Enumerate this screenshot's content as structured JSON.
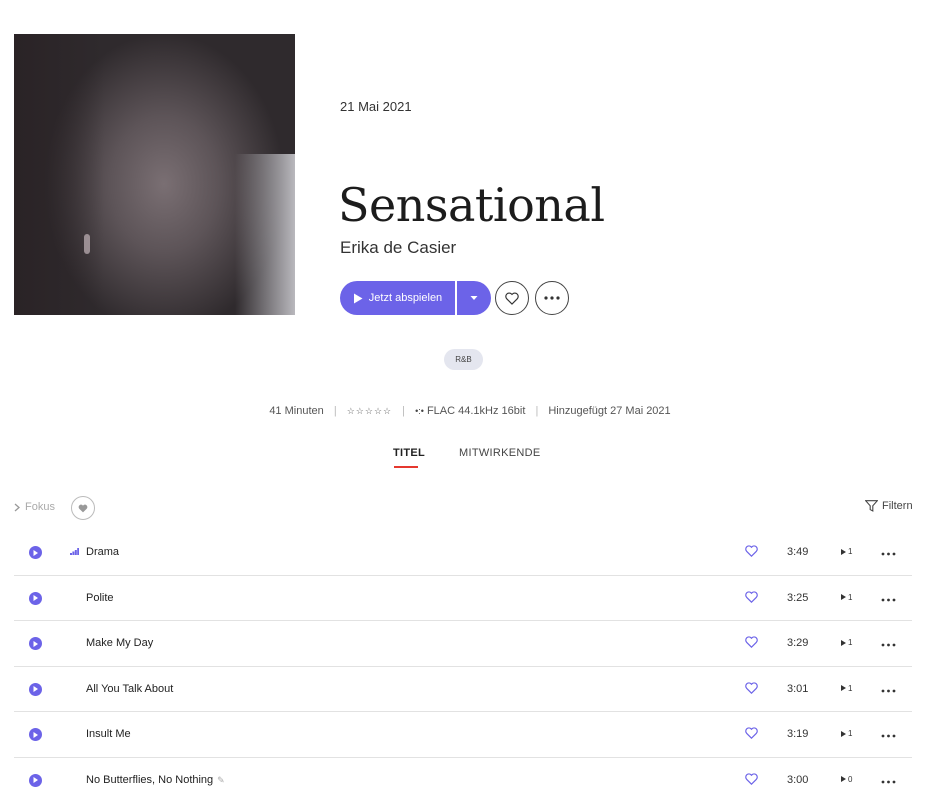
{
  "album": {
    "release_date": "21 Mai 2021",
    "title": "Sensational",
    "artist": "Erika de Casier",
    "genre": "R&B"
  },
  "actions": {
    "play_label": "Jetzt abspielen",
    "favorite_icon": "heart-outline-icon",
    "more_icon": "more-horizontal-icon"
  },
  "meta": {
    "duration": "41 Minuten",
    "rating_stars": "☆☆☆☆☆",
    "quality": "FLAC 44.1kHz 16bit",
    "added": "Hinzugefügt 27 Mai 2021"
  },
  "tabs": [
    {
      "label": "TITEL",
      "active": true
    },
    {
      "label": "MITWIRKENDE",
      "active": false
    }
  ],
  "toolbar": {
    "focus_label": "Fokus",
    "filter_label": "Filtern"
  },
  "tracks": [
    {
      "title": "Drama",
      "duration": "3:49",
      "plays": "1",
      "popular": true,
      "badge": ""
    },
    {
      "title": "Polite",
      "duration": "3:25",
      "plays": "1",
      "popular": false,
      "badge": ""
    },
    {
      "title": "Make My Day",
      "duration": "3:29",
      "plays": "1",
      "popular": false,
      "badge": ""
    },
    {
      "title": "All You Talk About",
      "duration": "3:01",
      "plays": "1",
      "popular": false,
      "badge": ""
    },
    {
      "title": "Insult Me",
      "duration": "3:19",
      "plays": "1",
      "popular": false,
      "badge": ""
    },
    {
      "title": "No Butterflies, No Nothing",
      "duration": "3:00",
      "plays": "0",
      "popular": false,
      "badge": "✎"
    }
  ],
  "colors": {
    "accent": "#6c63e8",
    "tab_underline": "#e5382f",
    "genre_bg": "#e4e6ef"
  }
}
